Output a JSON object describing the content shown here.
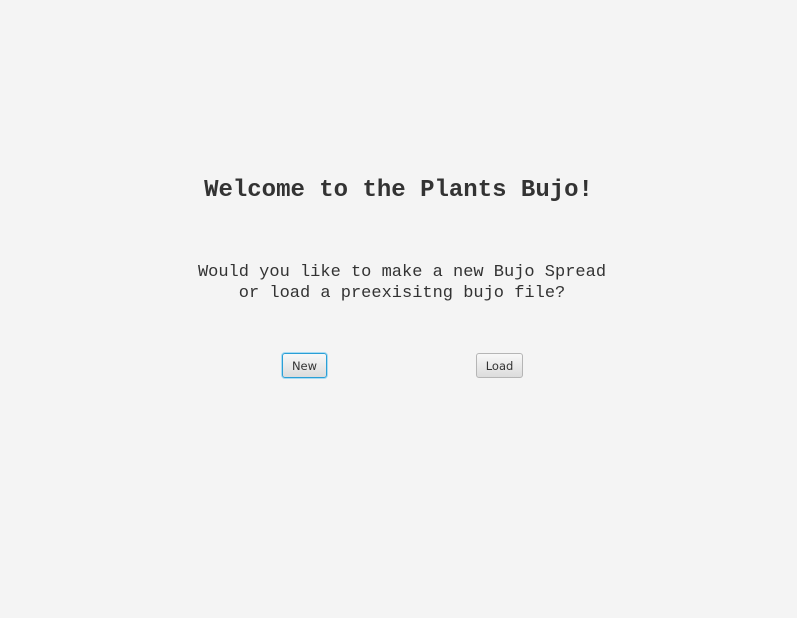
{
  "welcome": {
    "title": "Welcome to the Plants Bujo!"
  },
  "prompt": {
    "line1": "Would you like to make a new Bujo Spread",
    "line2": "or load a preexisitng bujo file?"
  },
  "buttons": {
    "new_label": "New",
    "load_label": "Load"
  },
  "colors": {
    "background": "#f4f4f4",
    "text": "#333333",
    "focus_ring": "#2a9fd6"
  }
}
